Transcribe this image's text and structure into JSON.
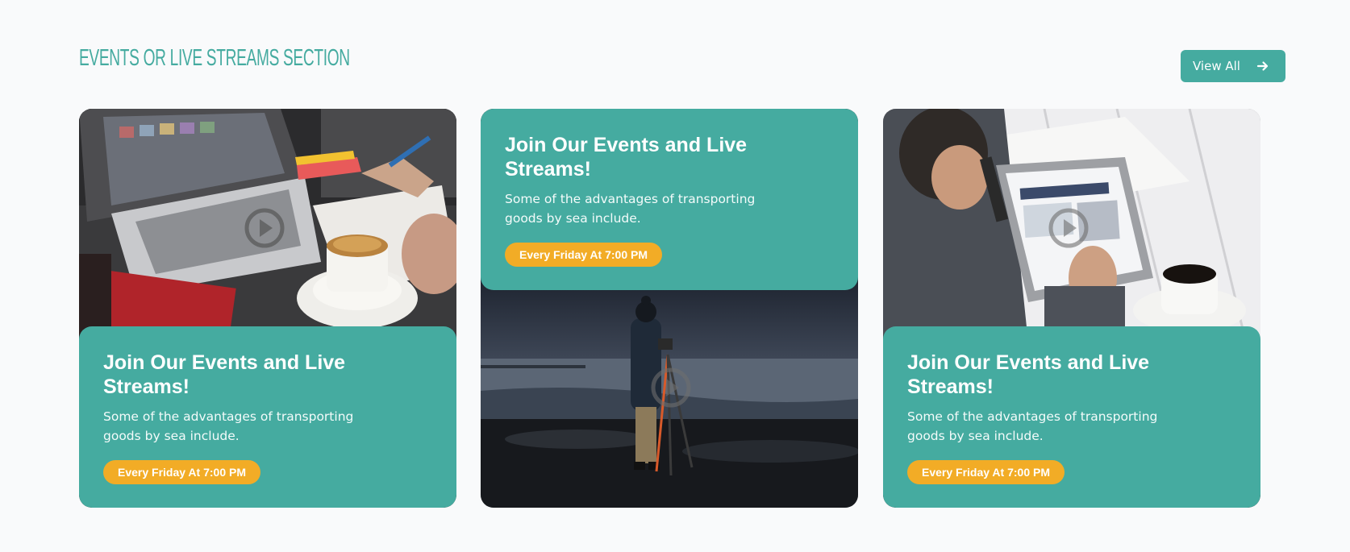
{
  "section": {
    "title": "EVENTS OR LIVE STREAMS SECTION",
    "view_all_label": "View All"
  },
  "icons": {
    "arrow": "arrow-right-icon",
    "play": "play-circle-icon"
  },
  "colors": {
    "accent": "#45aba0",
    "badge": "#f2ac26",
    "background": "#f9fafb"
  },
  "cards": [
    {
      "title": "Join Our Events and Live Streams!",
      "description": "Some of the advantages of transporting goods by sea include.",
      "badge": "Every Friday At 7:00 PM",
      "image": "laptop, notebook and coffee cup on a desk"
    },
    {
      "title": "Join Our Events and Live Streams!",
      "description": "Some of the advantages of transporting goods by sea include.",
      "badge": "Every Friday At 7:00 PM",
      "image": "photographer with camera on tripod at a stormy shore"
    },
    {
      "title": "Join Our Events and Live Streams!",
      "description": "Some of the advantages of transporting goods by sea include.",
      "badge": "Every Friday At 7:00 PM",
      "image": "person using a tablet next to a cup of coffee"
    }
  ]
}
